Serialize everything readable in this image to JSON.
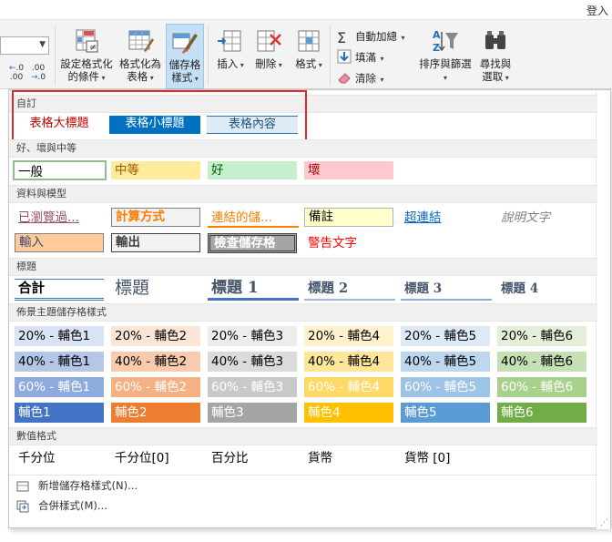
{
  "window": {
    "login_label": "登入"
  },
  "ribbon": {
    "number": {
      "inc_decimal": ".0",
      "dec_decimal": ".00",
      "arrow_a": "←",
      "arrow_b": "→",
      "inc_b": ".00",
      "dec_b": ".0"
    },
    "cond_format": {
      "line1": "設定格式化",
      "line2": "的條件"
    },
    "format_table": {
      "line1": "格式化為",
      "line2": "表格"
    },
    "cell_styles": {
      "line1": "儲存格",
      "line2": "樣式"
    },
    "insert": {
      "label": "插入"
    },
    "delete": {
      "label": "刪除"
    },
    "format": {
      "label": "格式"
    },
    "autosum": {
      "label": "自動加總"
    },
    "fill": {
      "label": "填滿"
    },
    "clear": {
      "label": "清除"
    },
    "sort_filter": {
      "line1": "排序與篩選"
    },
    "find_select": {
      "line1": "尋找與",
      "line2": "選取"
    },
    "accent_color": "#217346"
  },
  "gallery": {
    "sections": {
      "custom": "自訂",
      "good_bad": "好、壞與中等",
      "data_model": "資料與模型",
      "titles": "標題",
      "theme": "佈景主題儲存格樣式",
      "number_format": "數值格式"
    },
    "custom": [
      "表格大標題",
      "表格小標題",
      "表格內容"
    ],
    "good_bad": [
      "一般",
      "中等",
      "好",
      "壞"
    ],
    "data_model_row1": [
      "已瀏覽過...",
      "計算方式",
      "連結的儲...",
      "備註",
      "超連結",
      "說明文字"
    ],
    "data_model_row2": [
      "輸入",
      "輸出",
      "檢查儲存格",
      "警告文字"
    ],
    "titles": [
      "合計",
      "標題",
      "標題 1",
      "標題 2",
      "標題 3",
      "標題 4"
    ],
    "theme": {
      "row20": [
        "20% - 輔色1",
        "20% - 輔色2",
        "20% - 輔色3",
        "20% - 輔色4",
        "20% - 輔色5",
        "20% - 輔色6"
      ],
      "row40": [
        "40% - 輔色1",
        "40% - 輔色2",
        "40% - 輔色3",
        "40% - 輔色4",
        "40% - 輔色5",
        "40% - 輔色6"
      ],
      "row60": [
        "60% - 輔色1",
        "60% - 輔色2",
        "60% - 輔色3",
        "60% - 輔色4",
        "60% - 輔色5",
        "60% - 輔色6"
      ],
      "row100": [
        "輔色1",
        "輔色2",
        "輔色3",
        "輔色4",
        "輔色5",
        "輔色6"
      ],
      "colors": {
        "c20": [
          "#dae3f3",
          "#fbe5d6",
          "#ededed",
          "#fff2cc",
          "#deebf7",
          "#e2f0d9"
        ],
        "c40": [
          "#b4c7e7",
          "#f8cbad",
          "#dbdbdb",
          "#ffe699",
          "#bdd7ee",
          "#c5e0b4"
        ],
        "c60": [
          "#8faadc",
          "#f4b183",
          "#c9c9c9",
          "#ffd966",
          "#9dc3e6",
          "#a9d18e"
        ],
        "c100": [
          "#4472c4",
          "#ed7d31",
          "#a5a5a5",
          "#ffc000",
          "#5b9bd5",
          "#70ad47"
        ]
      }
    },
    "number_format": [
      "千分位",
      "千分位[0]",
      "百分比",
      "貨幣",
      "貨幣 [0]"
    ],
    "menu": [
      "新增儲存格樣式(N)...",
      "合併樣式(M)..."
    ]
  }
}
